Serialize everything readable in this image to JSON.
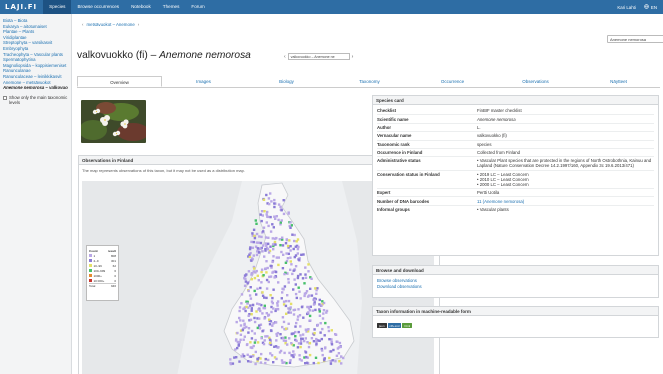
{
  "nav": {
    "logo": "LAJI.FI",
    "items": [
      "Species",
      "Browse occurrences",
      "Notebook",
      "Themes",
      "Forum"
    ],
    "active": 0,
    "user": "Kari Lahti",
    "language": "EN"
  },
  "sidebar": {
    "tree": [
      {
        "label": "Biota – Biota"
      },
      {
        "label": "Eukarya – aitotumaiset"
      },
      {
        "label": "Plantae – Plants"
      },
      {
        "label": "Viridiplantae"
      },
      {
        "label": "Streptophyta – varsikasvit"
      },
      {
        "label": "Embryophyta"
      },
      {
        "label": "Tracheophyta – Vascular plants"
      },
      {
        "label": "Spermatophytina"
      },
      {
        "label": "Magnoliopsida – koppisiemeniset"
      },
      {
        "label": "Ranunculanae"
      },
      {
        "label": "Ranunculaceae – leinikkikasvit"
      },
      {
        "label": "Anemone – metsävuokot"
      },
      {
        "label": "Anemone nemorosa – valkovuokko",
        "current": true
      }
    ],
    "checkbox_label": "Show only the main taxonomic levels"
  },
  "breadcrumb": {
    "back": "metsävuokot – Anemone",
    "forward": "›"
  },
  "search": {
    "value": "Anemone nemorosa"
  },
  "title": {
    "common": "valkovuokko (fi) – ",
    "scientific": "Anemone nemorosa"
  },
  "taxon_select": {
    "value": "valkovuokko – Anemone ne",
    "prev": "‹",
    "next": "›"
  },
  "tabs": [
    "Overview",
    "Images",
    "Biology",
    "Taxonomy",
    "Occurrence",
    "Observations",
    "Näytteet"
  ],
  "active_tab": 0,
  "observations": {
    "title": "Observations in Finland",
    "note": "The map represents observations of this taxon, but it may not be used as a distribution map.",
    "legend": {
      "col1": "Count",
      "col2": "result",
      "rows": [
        {
          "label": "1",
          "value": "808",
          "color": "#b9a7e6"
        },
        {
          "label": "2–9",
          "value": "301",
          "color": "#8a7bd6"
        },
        {
          "label": "10–99",
          "value": "62",
          "color": "#e4e066"
        },
        {
          "label": "100–999",
          "value": "6",
          "color": "#46c06a"
        },
        {
          "label": "1000+",
          "value": "0",
          "color": "#e48b2f"
        },
        {
          "label": "10 000+",
          "value": "0",
          "color": "#c9352f"
        }
      ],
      "total_label": "Total",
      "total_value": "946"
    }
  },
  "species_card": {
    "title": "Species card",
    "rows": [
      {
        "key": "Checklist",
        "value": "FinBIF master checklist"
      },
      {
        "key": "Scientific name",
        "value": "Anemone nemorosa",
        "italic": true
      },
      {
        "key": "Author",
        "value": "L."
      },
      {
        "key": "Vernacular name",
        "value": "valkovuokko (fi)"
      },
      {
        "key": "Taxonomic rank",
        "value": "species"
      },
      {
        "key": "Occurrence in Finland",
        "value": "Collected from Finland"
      },
      {
        "key": "Administrative status",
        "list": [
          "Vascular Plant species that are protected in the regions of North Ostrobothnia, Kainuu and Lapland (Nature Conservation Decree 14.2.1997/160, Appendix 3c 19.6.2013/471)"
        ]
      },
      {
        "key": "Conservation status in Finland",
        "list": [
          "2019 LC – Least Concern",
          "2010 LC – Least Concern",
          "2000 LC – Least Concern"
        ]
      },
      {
        "key": "Expert",
        "value": "Pertti Uotila"
      },
      {
        "key": "Number of DNA barcodes",
        "value": "11 (Anemone nemorosa)",
        "link": true
      },
      {
        "key": "Informal groups",
        "list": [
          "Vascular plants"
        ]
      }
    ]
  },
  "browse": {
    "title": "Browse and download",
    "links": [
      "Browse observations",
      "Download observations"
    ]
  },
  "machine": {
    "title": "Taxon information in machine-readable form",
    "badges": [
      {
        "label": "json",
        "color": "#333333"
      },
      {
        "label": "rdf+xml",
        "color": "#2e6da4"
      },
      {
        "label": "html",
        "color": "#5a9b3b"
      }
    ]
  },
  "colors": {
    "navbar": "#2e6da4",
    "navbar_active": "#1d5283",
    "link": "#1a6fb0",
    "sidebar_bg": "#f3f4f5"
  }
}
